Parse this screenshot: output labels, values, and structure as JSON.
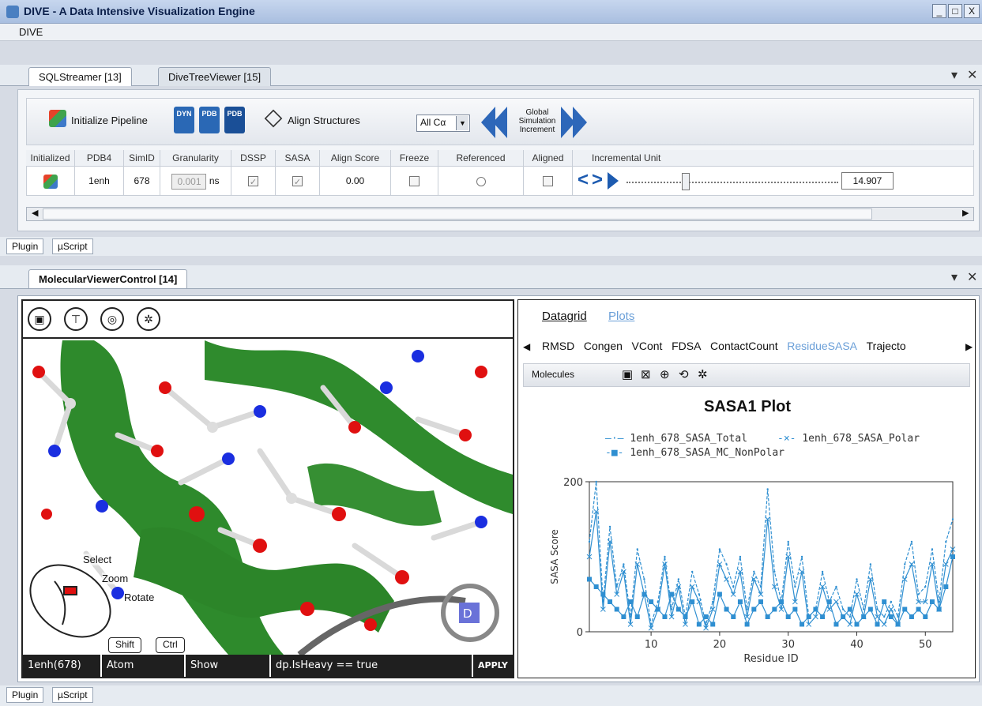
{
  "window": {
    "title": "DIVE - A Data Intensive Visualization Engine",
    "controls": [
      "_",
      "□",
      "X"
    ]
  },
  "menu": {
    "items": [
      "DIVE"
    ]
  },
  "top_tabs": [
    "SQLStreamer [13]",
    "DiveTreeViewer [15]"
  ],
  "toolbar": {
    "init_pipeline": "Initialize Pipeline",
    "icon_dyn": "DYN",
    "icon_pdb1": "PDB",
    "icon_pdb2": "PDB",
    "align_structures": "Align Structures",
    "align_combo": "All Cα",
    "gsi_line1": "Global",
    "gsi_line2": "Simulation",
    "gsi_line3": "Increment"
  },
  "grid": {
    "headers": [
      "Initialized",
      "PDB4",
      "SimID",
      "Granularity",
      "DSSP",
      "SASA",
      "Align Score",
      "Freeze",
      "Referenced",
      "Aligned",
      "Incremental Unit"
    ],
    "row": {
      "pdb4": "1enh",
      "simid": "678",
      "granularity_value": "0.001",
      "granularity_unit": "ns",
      "dssp": true,
      "sasa": true,
      "align_score": "0.00",
      "freeze": false,
      "referenced": false,
      "aligned": false,
      "slider_fraction": 0.27,
      "incremental_value": "14.907"
    }
  },
  "streamer_bottom_tabs": [
    "Plugin",
    "µScript"
  ],
  "viewer_tab": "MolecularViewerControl [14]",
  "viewer": {
    "mouse_labels": {
      "select": "Select",
      "zoom": "Zoom",
      "rotate": "Rotate",
      "shift": "Shift",
      "ctrl": "Ctrl"
    },
    "command": {
      "molecule": "1enh(678)",
      "scope": "Atom",
      "action": "Show",
      "expr": "dp.IsHeavy == true",
      "apply": "APPLY"
    }
  },
  "plots": {
    "views": [
      "Datagrid",
      "Plots"
    ],
    "tabs": [
      "RMSD",
      "Congen",
      "VCont",
      "FDSA",
      "ContactCount",
      "ResidueSASA",
      "Trajecto"
    ],
    "active_tab": "ResidueSASA",
    "molecules_label": "Molecules"
  },
  "bottom_tabs": [
    "Plugin",
    "µScript"
  ],
  "colors": {
    "series": "#2f8fd1",
    "link": "#6a9fd8"
  },
  "chart_data": {
    "type": "line",
    "title": "SASA1 Plot",
    "xlabel": "Residue ID",
    "ylabel": "SASA Score",
    "xlim": [
      1,
      54
    ],
    "ylim": [
      0,
      200
    ],
    "xticks": [
      10,
      20,
      30,
      40,
      50
    ],
    "yticks": [
      0,
      200
    ],
    "legend_position": "top",
    "x": [
      1,
      2,
      3,
      4,
      5,
      6,
      7,
      8,
      9,
      10,
      11,
      12,
      13,
      14,
      15,
      16,
      17,
      18,
      19,
      20,
      21,
      22,
      23,
      24,
      25,
      26,
      27,
      28,
      29,
      30,
      31,
      32,
      33,
      34,
      35,
      36,
      37,
      38,
      39,
      40,
      41,
      42,
      43,
      44,
      45,
      46,
      47,
      48,
      49,
      50,
      51,
      52,
      53,
      54
    ],
    "series": [
      {
        "name": "1enh_678_SASA_Total",
        "values": [
          120,
          200,
          40,
          140,
          60,
          90,
          20,
          110,
          70,
          10,
          40,
          100,
          30,
          70,
          20,
          80,
          50,
          10,
          40,
          110,
          90,
          60,
          100,
          30,
          80,
          60,
          190,
          80,
          40,
          120,
          60,
          100,
          20,
          30,
          80,
          40,
          60,
          30,
          20,
          70,
          30,
          90,
          30,
          20,
          40,
          20,
          90,
          120,
          50,
          60,
          110,
          40,
          120,
          150
        ]
      },
      {
        "name": "1enh_678_SASA_Polar",
        "values": [
          100,
          160,
          30,
          120,
          50,
          80,
          10,
          90,
          50,
          5,
          30,
          90,
          20,
          60,
          10,
          60,
          40,
          5,
          30,
          90,
          70,
          50,
          80,
          20,
          70,
          50,
          150,
          60,
          30,
          100,
          40,
          80,
          10,
          20,
          60,
          30,
          40,
          20,
          10,
          50,
          20,
          70,
          20,
          10,
          30,
          10,
          70,
          90,
          40,
          40,
          90,
          30,
          90,
          110
        ]
      },
      {
        "name": "1enh_678_SASA_MC_NonPolar",
        "values": [
          70,
          60,
          50,
          40,
          30,
          20,
          40,
          20,
          50,
          40,
          30,
          20,
          50,
          30,
          20,
          40,
          10,
          20,
          10,
          50,
          30,
          20,
          40,
          10,
          30,
          40,
          20,
          30,
          40,
          20,
          30,
          10,
          20,
          30,
          20,
          40,
          10,
          20,
          30,
          10,
          20,
          30,
          10,
          40,
          20,
          10,
          30,
          20,
          30,
          20,
          40,
          30,
          60,
          100
        ]
      }
    ]
  }
}
